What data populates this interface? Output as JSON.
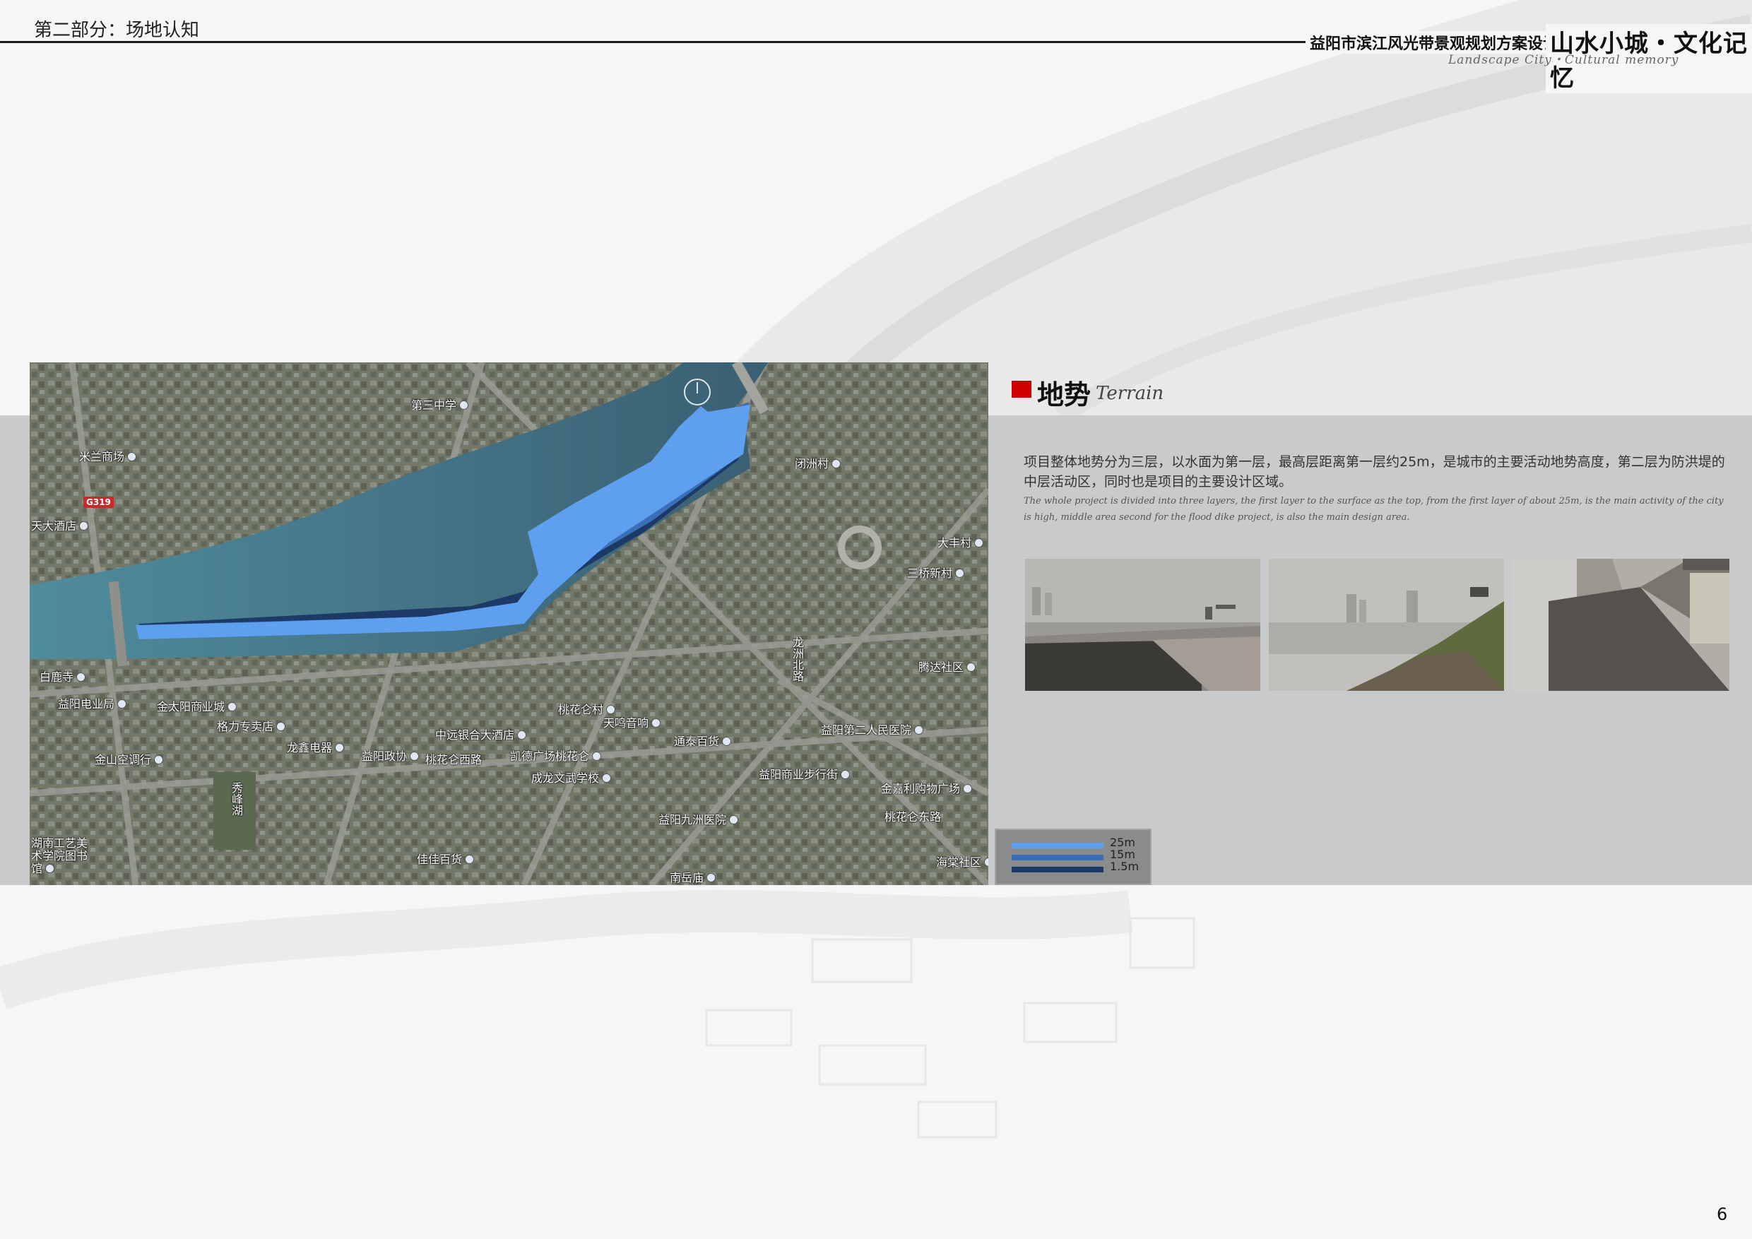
{
  "header": {
    "section": "第二部分：场地认知",
    "project_title": "益阳市滨江风光带景观规划方案设计",
    "slogan": "山水小城・文化记忆",
    "slogan_en": "Landscape City・Cultural memory"
  },
  "terrain": {
    "heading_cn": "地势",
    "heading_en": "Terrain",
    "description_cn": "项目整体地势分为三层，以水面为第一层，最高层距离第一层约25m，是城市的主要活动地势高度，第二层为防洪堤的中层活动区，同时也是项目的主要设计区域。",
    "description_en": "The whole project is divided into three layers, the first layer to the surface as the top, from the first layer of about 25m, is the main activity of the city is high, middle area second for the flood dike project, is also the main design area."
  },
  "map": {
    "labels": [
      "第三中学",
      "米兰商场",
      "G319",
      "天大酒店",
      "闭洲村",
      "大丰村",
      "三桥新村",
      "白鹿寺",
      "益阳电业局",
      "金太阳商业城",
      "格力专卖店",
      "龙鑫电器",
      "金山空调行",
      "秀峰湖",
      "益阳政协",
      "中远银合大酒店",
      "桃花仑西路",
      "凯德广场桃花仑",
      "桃花仑村",
      "天鸣音响",
      "通泰百货",
      "成龙文武学校",
      "益阳第二人民医院",
      "腾达社区",
      "金嘉利购物广场",
      "益阳商业步行街",
      "桃花仑东路",
      "益阳九洲医院",
      "海棠社区",
      "湖南工艺美术学院图书馆",
      "佳佳百货",
      "南岳庙",
      "龙洲北路"
    ]
  },
  "legend": [
    {
      "label": "25m",
      "color": "#5f9ff0"
    },
    {
      "label": "15m",
      "color": "#3a6fb8"
    },
    {
      "label": "1.5m",
      "color": "#1d3a66"
    }
  ],
  "page_number": "6",
  "colors": {
    "accent_red": "#d00000",
    "band_gray": "#c9cacb",
    "river": "#3f6f80",
    "terrain_top": "#5f9ff0",
    "terrain_mid": "#3a6fb8",
    "terrain_low": "#1d3a66"
  }
}
